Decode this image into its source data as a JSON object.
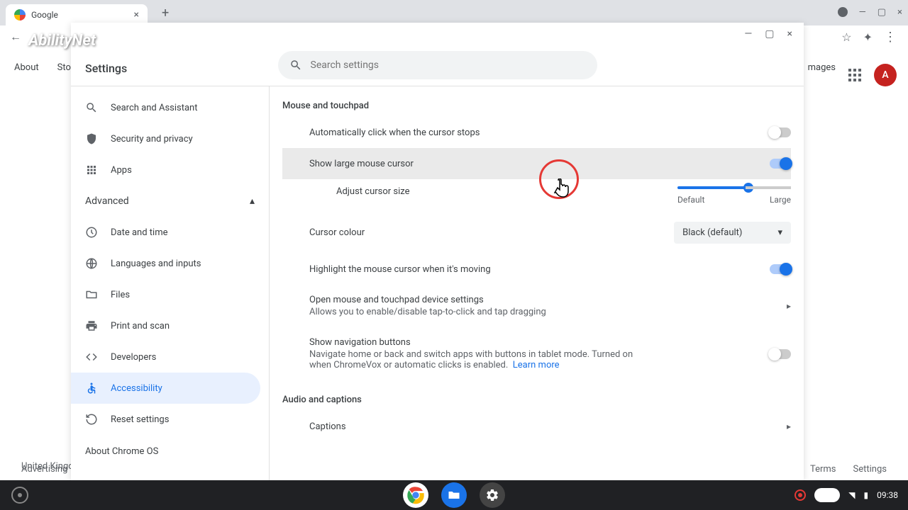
{
  "tab": {
    "title": "Google"
  },
  "watermark": "AbilityNet",
  "settings": {
    "title": "Settings",
    "search_placeholder": "Search settings"
  },
  "sidebar": {
    "items": [
      {
        "label": "Search and Assistant"
      },
      {
        "label": "Security and privacy"
      },
      {
        "label": "Apps"
      }
    ],
    "advanced_label": "Advanced",
    "adv_items": [
      {
        "label": "Date and time"
      },
      {
        "label": "Languages and inputs"
      },
      {
        "label": "Files"
      },
      {
        "label": "Print and scan"
      },
      {
        "label": "Developers"
      },
      {
        "label": "Accessibility"
      },
      {
        "label": "Reset settings"
      }
    ],
    "about": "About Chrome OS"
  },
  "content": {
    "section1": "Mouse and touchpad",
    "auto_click": "Automatically click when the cursor stops",
    "large_cursor": "Show large mouse cursor",
    "adjust_size": "Adjust cursor size",
    "slider_min": "Default",
    "slider_max": "Large",
    "cursor_colour": "Cursor colour",
    "cursor_colour_value": "Black (default)",
    "highlight": "Highlight the mouse cursor when it's moving",
    "open_device": "Open mouse and touchpad device settings",
    "open_device_desc": "Allows you to enable/disable tap-to-click and tap dragging",
    "nav_buttons": "Show navigation buttons",
    "nav_buttons_desc": "Navigate home or back and switch apps with buttons in tablet mode. Turned on when ChromeVox or automatic clicks is enabled.",
    "learn_more": "Learn more",
    "section2": "Audio and captions",
    "captions": "Captions"
  },
  "bg": {
    "about": "About",
    "store": "Stor",
    "images": "mages",
    "avatar": "A",
    "uk": "United Kingd",
    "advertising": "Advertising",
    "terms": "Terms",
    "settings": "Settings"
  },
  "shelf": {
    "time": "09:38"
  }
}
